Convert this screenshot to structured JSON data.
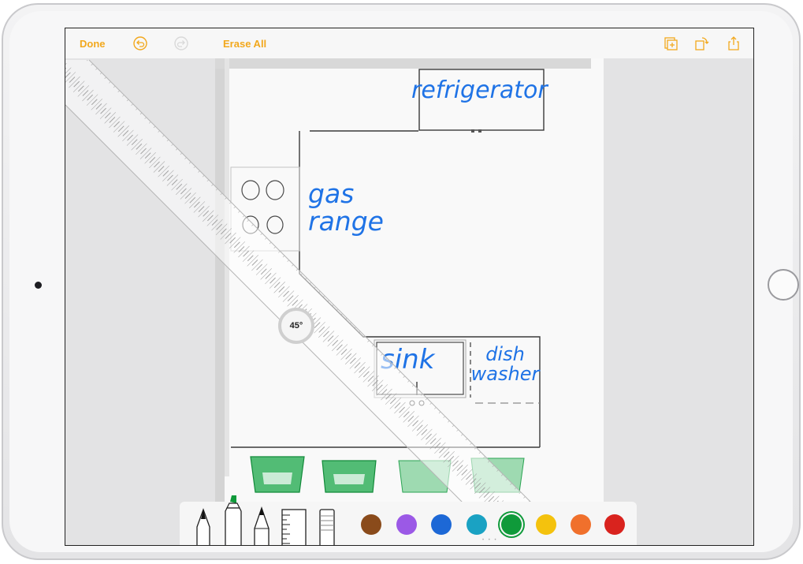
{
  "toolbar": {
    "done_label": "Done",
    "erase_all_label": "Erase All",
    "accent_color": "#f2a81d",
    "icons": [
      "undo-icon",
      "redo-icon",
      "add-page-icon",
      "rotate-icon",
      "share-icon"
    ]
  },
  "drawing": {
    "labels": {
      "refrigerator": "refrigerator",
      "gas_range": "gas range",
      "sink": "sink",
      "dishwasher": "dish washer"
    },
    "ruler_angle": "45°"
  },
  "tools": {
    "items": [
      "pen-tool",
      "marker-tool",
      "pencil-tool",
      "ruler-tool",
      "eraser-tool"
    ],
    "colors": [
      {
        "name": "brown",
        "hex": "#8a4b1b"
      },
      {
        "name": "purple",
        "hex": "#9b59e6"
      },
      {
        "name": "blue",
        "hex": "#1d68d6"
      },
      {
        "name": "teal",
        "hex": "#1aa2c3"
      },
      {
        "name": "green",
        "hex": "#0f9a3a",
        "selected": true
      },
      {
        "name": "yellow",
        "hex": "#f4c20d"
      },
      {
        "name": "orange",
        "hex": "#f0702c"
      },
      {
        "name": "red",
        "hex": "#d9231e"
      }
    ]
  }
}
